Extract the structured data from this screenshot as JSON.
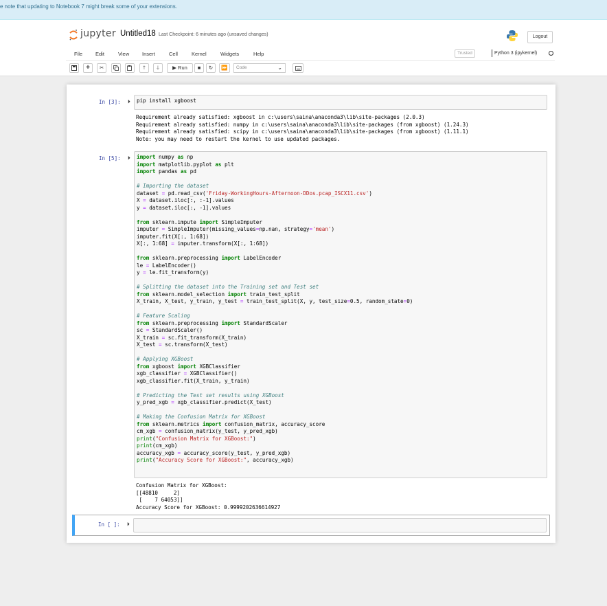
{
  "notice": {
    "text": "e note that updating to Notebook 7 might break some of your extensions."
  },
  "header": {
    "logo_text": "jupyter",
    "notebook_title": "Untitled18",
    "checkpoint": "Last Checkpoint: 6 minutes ago  (unsaved changes)",
    "logout_label": "Logout"
  },
  "menu": {
    "items": [
      "File",
      "Edit",
      "View",
      "Insert",
      "Cell",
      "Kernel",
      "Widgets",
      "Help"
    ],
    "trusted_label": "Trusted",
    "kernel_name": "Python 3 (ipykernel)"
  },
  "toolbar": {
    "run_label": "Run",
    "cell_type": "Code"
  },
  "cells": [
    {
      "prompt": "In [3]:",
      "source_lines": [
        "pip install xgboost"
      ],
      "output_lines": [
        "Requirement already satisfied: xgboost in c:\\users\\saina\\anaconda3\\lib\\site-packages (2.0.3)",
        "Requirement already satisfied: numpy in c:\\users\\saina\\anaconda3\\lib\\site-packages (from xgboost) (1.24.3)",
        "Requirement already satisfied: scipy in c:\\users\\saina\\anaconda3\\lib\\site-packages (from xgboost) (1.11.1)",
        "Note: you may need to restart the kernel to use updated packages."
      ]
    },
    {
      "prompt": "In [5]:",
      "source_lines": [
        "import numpy as np",
        "import matplotlib.pyplot as plt",
        "import pandas as pd",
        "",
        "# Importing the dataset",
        "dataset = pd.read_csv('Friday-WorkingHours-Afternoon-DDos.pcap_ISCX11.csv')",
        "X = dataset.iloc[:, :-1].values",
        "y = dataset.iloc[:, -1].values",
        "",
        "from sklearn.impute import SimpleImputer",
        "imputer = SimpleImputer(missing_values=np.nan, strategy='mean')",
        "imputer.fit(X[:, 1:68])",
        "X[:, 1:68] = imputer.transform(X[:, 1:68])",
        "",
        "from sklearn.preprocessing import LabelEncoder",
        "le = LabelEncoder()",
        "y = le.fit_transform(y)",
        "",
        "# Splitting the dataset into the Training set and Test set",
        "from sklearn.model_selection import train_test_split",
        "X_train, X_test, y_train, y_test = train_test_split(X, y, test_size=0.5, random_state=0)",
        "",
        "# Feature Scaling",
        "from sklearn.preprocessing import StandardScaler",
        "sc = StandardScaler()",
        "X_train = sc.fit_transform(X_train)",
        "X_test = sc.transform(X_test)",
        "",
        "# Applying XGBoost",
        "from xgboost import XGBClassifier",
        "xgb_classifier = XGBClassifier()",
        "xgb_classifier.fit(X_train, y_train)",
        "",
        "# Predicting the Test set results using XGBoost",
        "y_pred_xgb = xgb_classifier.predict(X_test)",
        "",
        "# Making the Confusion Matrix for XGBoost",
        "from sklearn.metrics import confusion_matrix, accuracy_score",
        "cm_xgb = confusion_matrix(y_test, y_pred_xgb)",
        "print(\"Confusion Matrix for XGBoost:\")",
        "print(cm_xgb)",
        "accuracy_xgb = accuracy_score(y_test, y_pred_xgb)",
        "print(\"Accuracy Score for XGBoost:\", accuracy_xgb)"
      ],
      "output_lines": [
        "Confusion Matrix for XGBoost:",
        "[[48810     2]",
        " [    7 64053]]",
        "Accuracy Score for XGBoost: 0.9999202636614927"
      ]
    },
    {
      "prompt": "In [ ]:",
      "source_lines": [],
      "output_lines": []
    }
  ]
}
